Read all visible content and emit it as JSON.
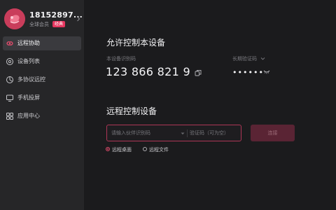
{
  "profile": {
    "username": "18152897...",
    "member_label": "全球会员",
    "badge": "经典"
  },
  "sidebar": {
    "items": [
      {
        "label": "远程协助",
        "icon": "remote-assist-icon",
        "active": true
      },
      {
        "label": "设备列表",
        "icon": "device-list-icon",
        "active": false
      },
      {
        "label": "多协议远控",
        "icon": "multi-protocol-icon",
        "active": false
      },
      {
        "label": "手机投屏",
        "icon": "phone-cast-icon",
        "active": false
      },
      {
        "label": "应用中心",
        "icon": "app-center-icon",
        "active": false
      }
    ]
  },
  "allow_section": {
    "title": "允许控制本设备",
    "device_id_label": "本设备识别码",
    "device_id": "123 866 821 9",
    "verify_label": "长期验证码",
    "verify_value": "••••••"
  },
  "remote_section": {
    "title": "远程控制设备",
    "partner_placeholder": "请输入伙伴识别码",
    "code_placeholder": "验证码（可为空）",
    "connect_label": "连接",
    "mode_desktop": "远程桌面",
    "mode_files": "远程文件"
  },
  "colors": {
    "accent": "#e04c6c",
    "sidebar_bg": "#262628",
    "main_bg": "#1b1b1d"
  }
}
